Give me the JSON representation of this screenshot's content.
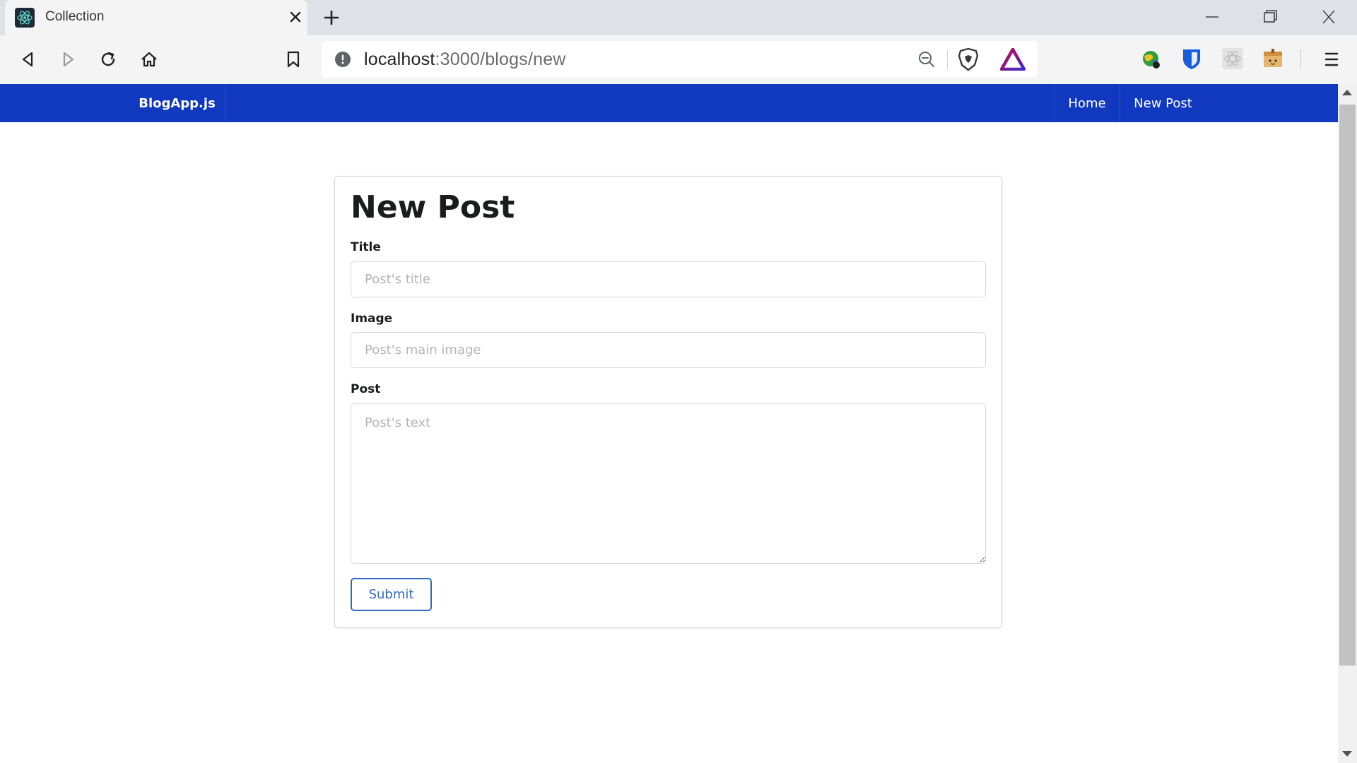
{
  "browser": {
    "tab_title": "Collection",
    "url_host": "localhost",
    "url_path": ":3000/blogs/new"
  },
  "icons": {
    "favicon": "react-icon",
    "tab_close": "close-icon",
    "new_tab": "plus-icon",
    "back": "back-arrow-icon",
    "forward": "forward-arrow-icon",
    "reload": "reload-icon",
    "home": "home-icon",
    "bookmark": "bookmark-icon",
    "site_info": "info-icon",
    "zoom": "zoom-out-icon",
    "shields": "brave-shield-icon",
    "rewards": "brave-rewards-icon",
    "extensions": [
      "globe-extension-icon",
      "bitwarden-icon",
      "react-devtools-icon",
      "box-extension-icon"
    ],
    "menu": "hamburger-menu-icon"
  },
  "site": {
    "brand": "BlogApp.js",
    "nav": {
      "home": "Home",
      "new_post": "New Post"
    }
  },
  "form": {
    "heading": "New Post",
    "title_label": "Title",
    "title_placeholder": "Post's title",
    "image_label": "Image",
    "image_placeholder": "Post's main image",
    "post_label": "Post",
    "post_placeholder": "Post's text",
    "submit_label": "Submit"
  },
  "colors": {
    "navbar": "#1139bf",
    "submit_border": "#2d6ac4",
    "tab_strip": "#dee1e6",
    "toolbar": "#f4f4f4"
  }
}
